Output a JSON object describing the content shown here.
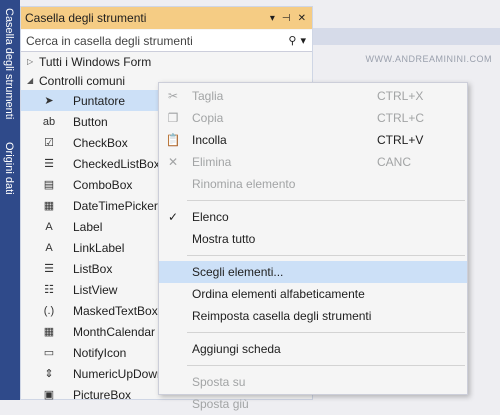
{
  "side_tabs": [
    "Casella degli strumenti",
    "Origini dati"
  ],
  "toolbox": {
    "title": "Casella degli strumenti",
    "search": {
      "placeholder": "Cerca in casella degli strumenti"
    },
    "groups": [
      {
        "label": "Tutti i Windows Form",
        "expanded": false
      },
      {
        "label": "Controlli comuni",
        "expanded": true
      }
    ],
    "items": [
      {
        "label": "Puntatore",
        "icon": "pointer-icon",
        "glyph": "➤"
      },
      {
        "label": "Button",
        "icon": "button-icon",
        "glyph": "ab"
      },
      {
        "label": "CheckBox",
        "icon": "checkbox-icon",
        "glyph": "☑"
      },
      {
        "label": "CheckedListBox",
        "icon": "checked-listbox-icon",
        "glyph": "☰"
      },
      {
        "label": "ComboBox",
        "icon": "combobox-icon",
        "glyph": "▤"
      },
      {
        "label": "DateTimePicker",
        "icon": "datetimepicker-icon",
        "glyph": "▦"
      },
      {
        "label": "Label",
        "icon": "label-icon",
        "glyph": "A"
      },
      {
        "label": "LinkLabel",
        "icon": "linklabel-icon",
        "glyph": "A"
      },
      {
        "label": "ListBox",
        "icon": "listbox-icon",
        "glyph": "☰"
      },
      {
        "label": "ListView",
        "icon": "listview-icon",
        "glyph": "☷"
      },
      {
        "label": "MaskedTextBox",
        "icon": "maskedtextbox-icon",
        "glyph": "(.)"
      },
      {
        "label": "MonthCalendar",
        "icon": "monthcalendar-icon",
        "glyph": "▦"
      },
      {
        "label": "NotifyIcon",
        "icon": "notifyicon-icon",
        "glyph": "▭"
      },
      {
        "label": "NumericUpDown",
        "icon": "numericupdown-icon",
        "glyph": "⇕"
      },
      {
        "label": "PictureBox",
        "icon": "picturebox-icon",
        "glyph": "▣"
      }
    ]
  },
  "designer": {
    "watermark": "WWW.ANDREAMININI.COM"
  },
  "context_menu": {
    "items": [
      {
        "label": "Taglia",
        "shortcut": "CTRL+X",
        "icon": "cut-icon",
        "glyph": "✂",
        "disabled": true
      },
      {
        "label": "Copia",
        "shortcut": "CTRL+C",
        "icon": "copy-icon",
        "glyph": "❐",
        "disabled": true
      },
      {
        "label": "Incolla",
        "shortcut": "CTRL+V",
        "icon": "paste-icon",
        "glyph": "📋",
        "disabled": false
      },
      {
        "label": "Elimina",
        "shortcut": "CANC",
        "icon": "delete-icon",
        "glyph": "✕",
        "disabled": true
      },
      {
        "label": "Rinomina elemento",
        "shortcut": "",
        "disabled": true
      },
      {
        "label": "Elenco",
        "shortcut": "",
        "icon": "checkmark-icon",
        "glyph": "✓",
        "disabled": false
      },
      {
        "label": "Mostra tutto",
        "shortcut": "",
        "disabled": false
      },
      {
        "label": "Scegli elementi...",
        "shortcut": "",
        "disabled": false
      },
      {
        "label": "Ordina elementi alfabeticamente",
        "shortcut": "",
        "disabled": false
      },
      {
        "label": "Reimposta casella degli strumenti",
        "shortcut": "",
        "disabled": false
      },
      {
        "label": "Aggiungi scheda",
        "shortcut": "",
        "disabled": false
      },
      {
        "label": "Sposta su",
        "shortcut": "",
        "disabled": true
      },
      {
        "label": "Sposta giù",
        "shortcut": "",
        "disabled": true
      }
    ]
  },
  "colors": {
    "sidebar": "#2f4a8a",
    "header": "#f5cc84",
    "selection": "#cce0f7",
    "disabled_text": "#a2a4a5"
  }
}
